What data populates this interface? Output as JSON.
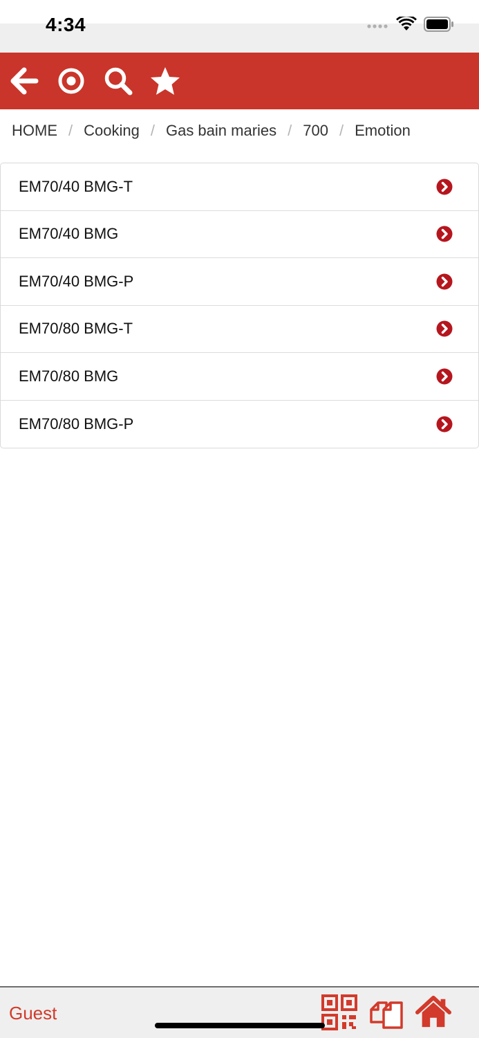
{
  "status": {
    "time": "4:34"
  },
  "toolbar": {
    "accent": "#c9352a"
  },
  "breadcrumb": [
    {
      "label": "HOME"
    },
    {
      "label": "Cooking"
    },
    {
      "label": "Gas bain maries"
    },
    {
      "label": "700"
    },
    {
      "label": "Emotion"
    }
  ],
  "breadcrumb_separator": "/",
  "products": [
    {
      "label": "EM70/40 BMG-T"
    },
    {
      "label": "EM70/40 BMG"
    },
    {
      "label": "EM70/40 BMG-P"
    },
    {
      "label": "EM70/80 BMG-T"
    },
    {
      "label": "EM70/80 BMG"
    },
    {
      "label": "EM70/80 BMG-P"
    }
  ],
  "bottom": {
    "user_label": "Guest"
  },
  "icons": {
    "toolbar": [
      "back-arrow-icon",
      "target-icon",
      "search-icon",
      "star-icon"
    ],
    "list_item": "chevron-right-circle-icon",
    "bottom": [
      "qr-code-icon",
      "documents-icon",
      "home-icon"
    ]
  },
  "colors": {
    "brand": "#c9352a",
    "chevron": "#b5161e",
    "guest_text": "#d23a2b"
  }
}
